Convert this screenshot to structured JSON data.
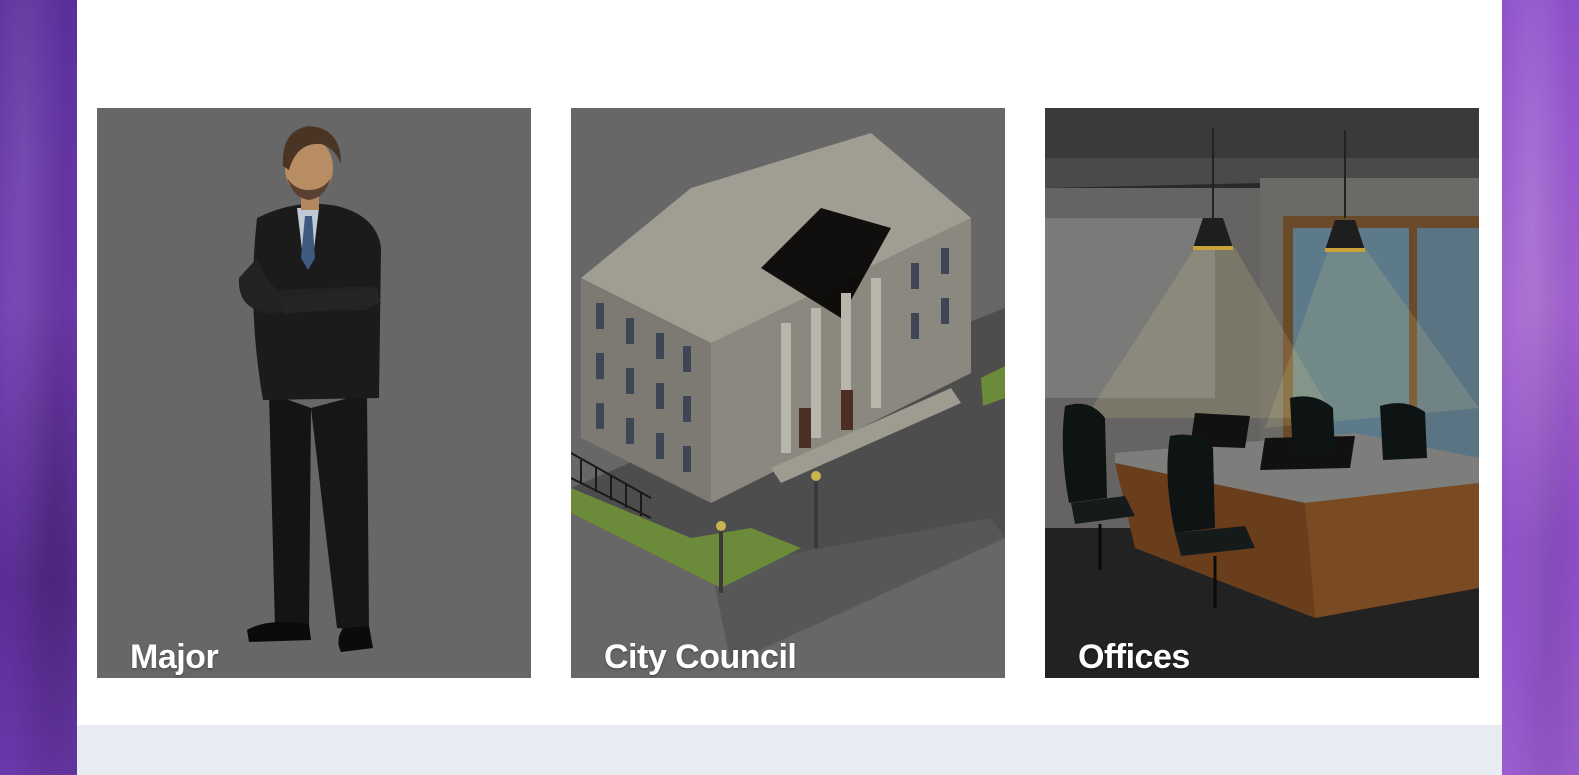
{
  "cards": [
    {
      "label": "Major",
      "icon": "arrow-right-icon"
    },
    {
      "label": "City Council",
      "icon": "arrow-right-icon"
    },
    {
      "label": "Offices",
      "icon": "arrow-right-icon"
    }
  ],
  "colors": {
    "page_bg_left": "#5a2f9a",
    "page_bg_right": "#9b5cd0",
    "content_bg": "#ffffff",
    "footer_band": "#e8ebf1",
    "card_overlay": "#676767",
    "label_text": "#ffffff"
  }
}
